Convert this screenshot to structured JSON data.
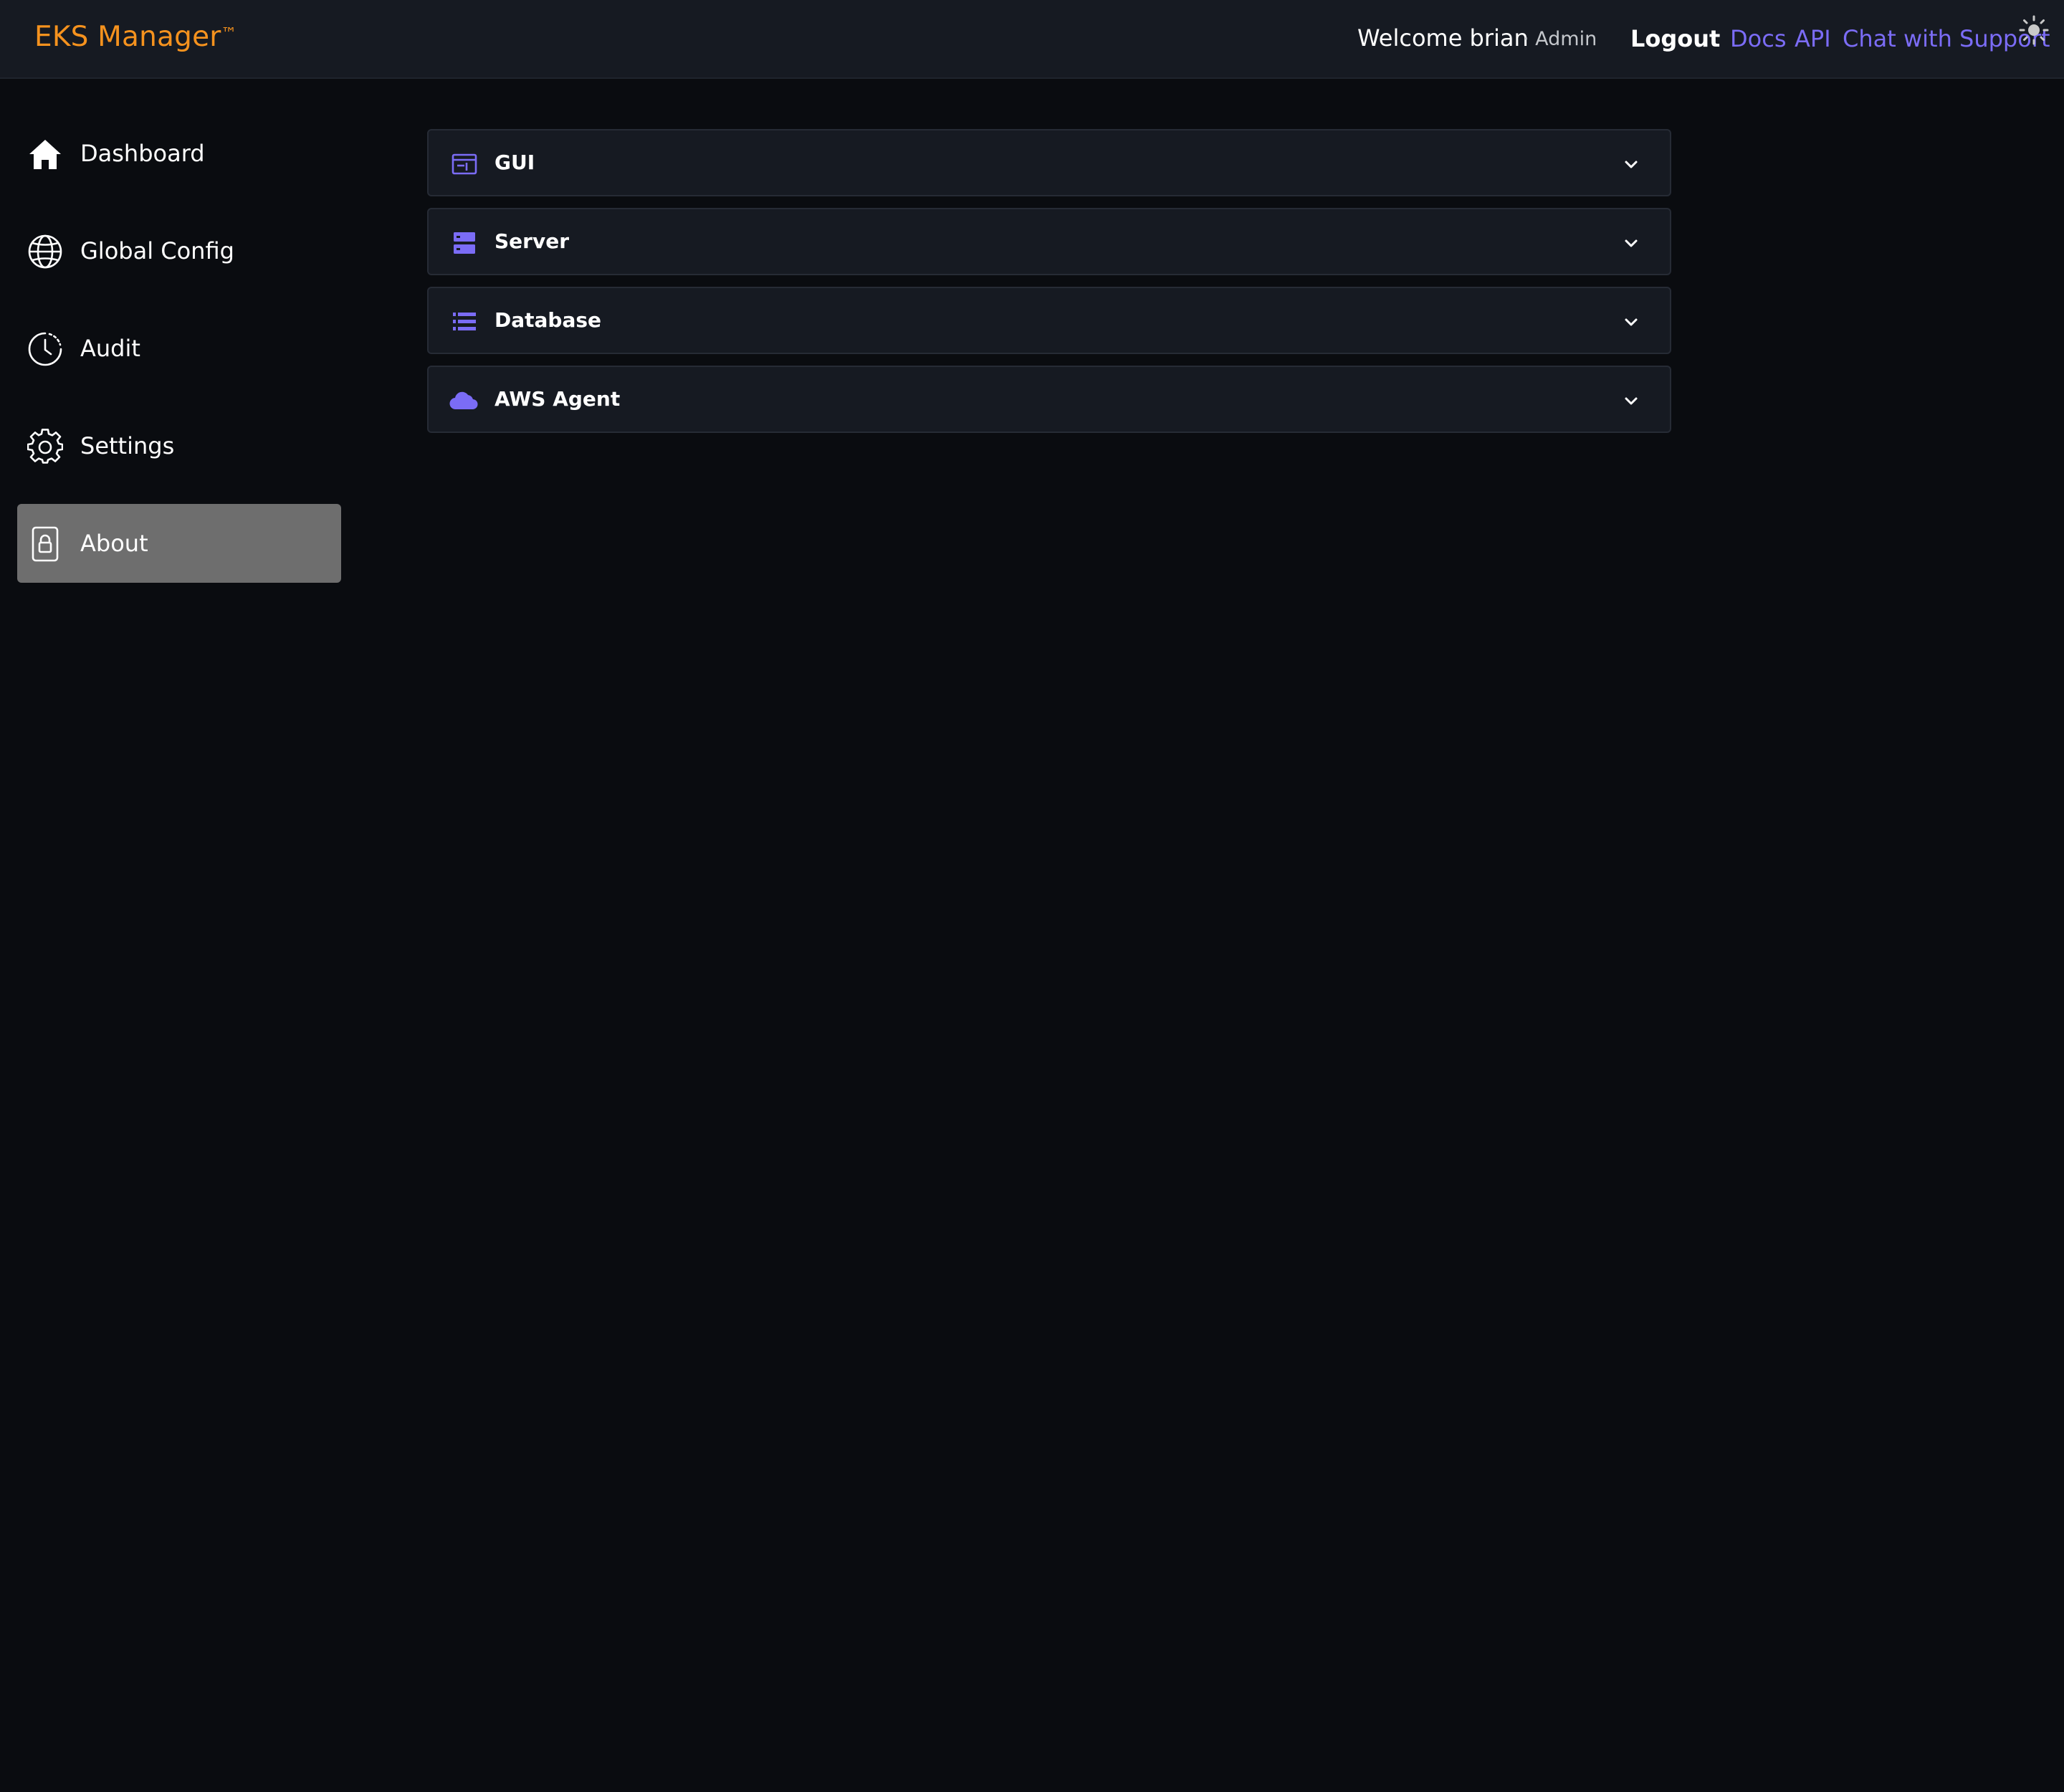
{
  "header": {
    "brand": "EKS Manager",
    "brand_mark": "™",
    "welcome_text": "Welcome brian",
    "role_text": "· Admin",
    "logout_label": "Logout",
    "links": [
      {
        "label": "Docs",
        "icon": "none"
      },
      {
        "label": "API",
        "icon": "none"
      },
      {
        "label": "Chat with Support",
        "icon": "none"
      }
    ],
    "theme_toggle_icon": "sun-icon"
  },
  "sidebar": {
    "active_item": "About",
    "items": [
      {
        "label": "Dashboard",
        "icon": "home-icon"
      },
      {
        "label": "Global Config",
        "icon": "globe-icon"
      },
      {
        "label": "Audit",
        "icon": "clock-icon"
      },
      {
        "label": "Settings",
        "icon": "gear-icon"
      },
      {
        "label": "About",
        "icon": "lock-icon"
      }
    ]
  },
  "accordion": {
    "sections": [
      {
        "label": "GUI",
        "icon": "window-icon",
        "expanded": false
      },
      {
        "label": "Server",
        "icon": "server-icon",
        "expanded": false
      },
      {
        "label": "Database",
        "icon": "database-list-icon",
        "expanded": false
      },
      {
        "label": "AWS Agent",
        "icon": "cloud-icon",
        "expanded": false
      }
    ]
  },
  "colors": {
    "brand": "#f5921e",
    "link": "#7b6cf6",
    "accent_icon": "#7b6cf6",
    "active_nav_bg": "#6e6e6e",
    "page_bg": "#0a0c10",
    "panel_bg": "#161a22"
  }
}
